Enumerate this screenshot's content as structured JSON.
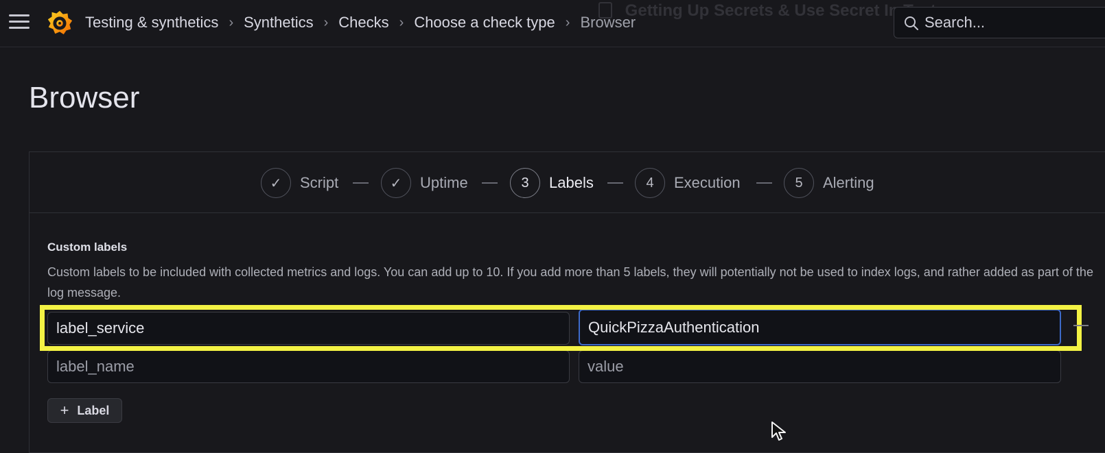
{
  "window": {
    "recording_title": "Getting Up Secrets & Use Secret In Test.mov"
  },
  "topbar": {
    "breadcrumbs": [
      "Testing & synthetics",
      "Synthetics",
      "Checks",
      "Choose a check type",
      "Browser"
    ],
    "separator": "›",
    "search_placeholder": "Search..."
  },
  "page": {
    "title": "Browser"
  },
  "wizard": {
    "steps": [
      {
        "marker": "✓",
        "label": "Script",
        "state": "done"
      },
      {
        "marker": "✓",
        "label": "Uptime",
        "state": "done"
      },
      {
        "marker": "3",
        "label": "Labels",
        "state": "active"
      },
      {
        "marker": "4",
        "label": "Execution",
        "state": "upcoming"
      },
      {
        "marker": "5",
        "label": "Alerting",
        "state": "upcoming"
      }
    ]
  },
  "custom_labels": {
    "title": "Custom labels",
    "description": "Custom labels to be included with collected metrics and logs. You can add up to 10. If you add more than 5 labels, they will potentially not be used to index logs, and rather added as part of the log message.",
    "rows": [
      {
        "name_value": "label_service",
        "name_placeholder": "label_name",
        "value_value": "QuickPizzaAuthentication",
        "value_placeholder": "value"
      },
      {
        "name_value": "",
        "name_placeholder": "label_name",
        "value_value": "",
        "value_placeholder": "value"
      }
    ],
    "add_button_label": "Label"
  },
  "colors": {
    "background": "#18181c",
    "highlight": "#f3f244",
    "focus_border": "#3d6ac9",
    "grafana_orange": "#f46800"
  }
}
